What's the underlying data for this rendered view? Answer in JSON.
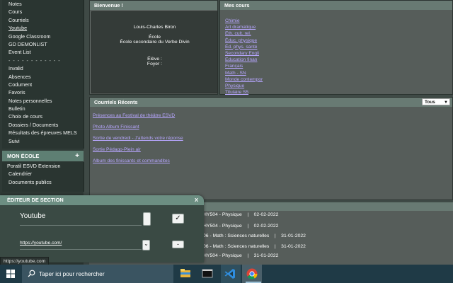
{
  "sidebar": {
    "top_items": [
      "Notes",
      "Cours",
      "Courriels",
      "Youtube",
      "Google Classroom",
      "GD DEMONLIST",
      "Event List",
      "- - - - - - - - - - - -",
      "Invalid",
      "Absences",
      "Codument",
      "Favoris",
      "Notes personnelles",
      "Bulletin",
      "Choix de cours",
      "Dossiers / Documents",
      "Résultats des épreuves MELS",
      "Suivi"
    ],
    "school_title": "MON ÉCOLE",
    "school_items": [
      "Poratil ESVD Extension",
      "Calendrier",
      "Documents publics"
    ]
  },
  "welcome": {
    "title": "Bienvenue !",
    "name": "Louis-Charles Biron",
    "school_label": "École",
    "school_name": "École secondaire du Verbe Divin",
    "eleve_label": "Élève :",
    "foyer_label": "Foyer :"
  },
  "courses": {
    "title": "Mes cours",
    "items": [
      "Chimie",
      "Art dramatique",
      "Eth. cult. rel.",
      "Éduc. physique",
      "Éd. phys. santé",
      "Secondary Engli",
      "Education finan",
      "Français",
      "Math - SN",
      "Monde contempor",
      "Physique",
      "Titulaire S5"
    ]
  },
  "mail": {
    "title": "Courriels Récents",
    "filter_value": "Tous",
    "items": [
      "Présences au Festival de théâtre ESVD",
      "Photo Album Finissant",
      "Sortie de vendredi - J'attends votre réponse",
      "Sortie Pédago-Plein air",
      "Album des finissants et commandites"
    ]
  },
  "homework_rows": [
    "HY504 - Physique    |    02-02-2022",
    "HY504 - Physique    |    02-02-2022",
    "06 - Math : Sciences naturelles    |    31-01-2022",
    "06 - Math : Sciences naturelles    |    31-01-2022",
    "HY504 - Physique    |    31-01-2022"
  ],
  "editor": {
    "title": "ÉDITEUR DE SECTION",
    "close": "X",
    "name_value": "Youtube",
    "url_value": "https://youtube.com/",
    "confirm": "✓",
    "remove": "-",
    "dropdown": "⌄"
  },
  "status_url": "https://youtube.com",
  "taskbar": {
    "search_placeholder": "Taper ici pour rechercher"
  }
}
